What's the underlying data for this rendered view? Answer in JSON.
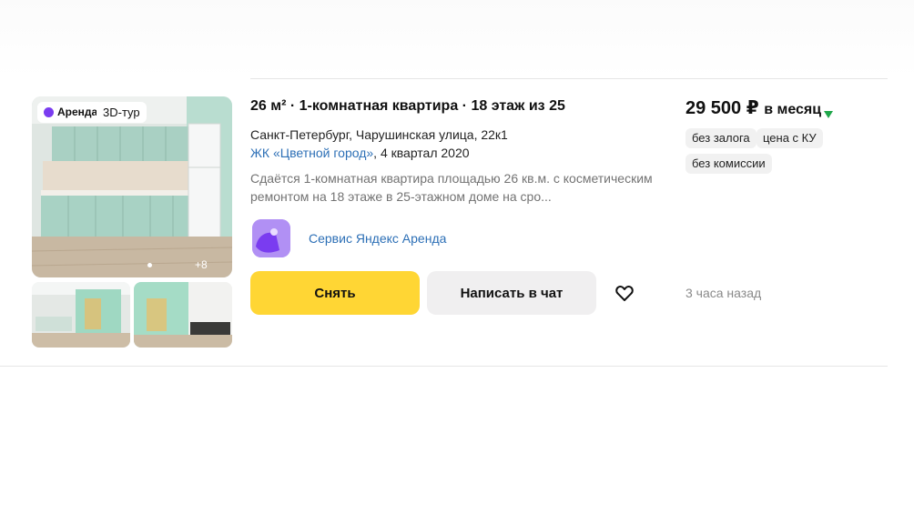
{
  "listing": {
    "badges": {
      "rent": "Аренда",
      "tour": "3D-тур"
    },
    "photo_count": "+8",
    "title": "26 м² · 1-комнатная квартира · 18 этаж из 25",
    "address": "Санкт-Петербург, Чарушинская улица, 22к1",
    "complex_name": "ЖК «Цветной город»",
    "complex_suffix": ", 4 квартал 2020",
    "description": "Сдаётся 1-комнатная квартира площадью 26 кв.м. с косметическим ремонтом на 18 этаже в 25-этажном доме на сро...",
    "service": "Сервис Яндекс Аренда",
    "buttons": {
      "rent": "Снять",
      "chat": "Написать в чат"
    },
    "favorite_icon": "heart-icon",
    "price": {
      "amount": "29 500 ₽",
      "period": "в месяц",
      "trend_icon": "arrow-down-icon",
      "trend_color": "#1fa64a"
    },
    "tags": [
      "без залога",
      "цена с КУ",
      "без комиссии"
    ],
    "posted": "3 часа назад"
  },
  "colors": {
    "accent_yellow": "#ffd634",
    "link_blue": "#2c6fb6",
    "brand_purple": "#7a3cf0"
  }
}
